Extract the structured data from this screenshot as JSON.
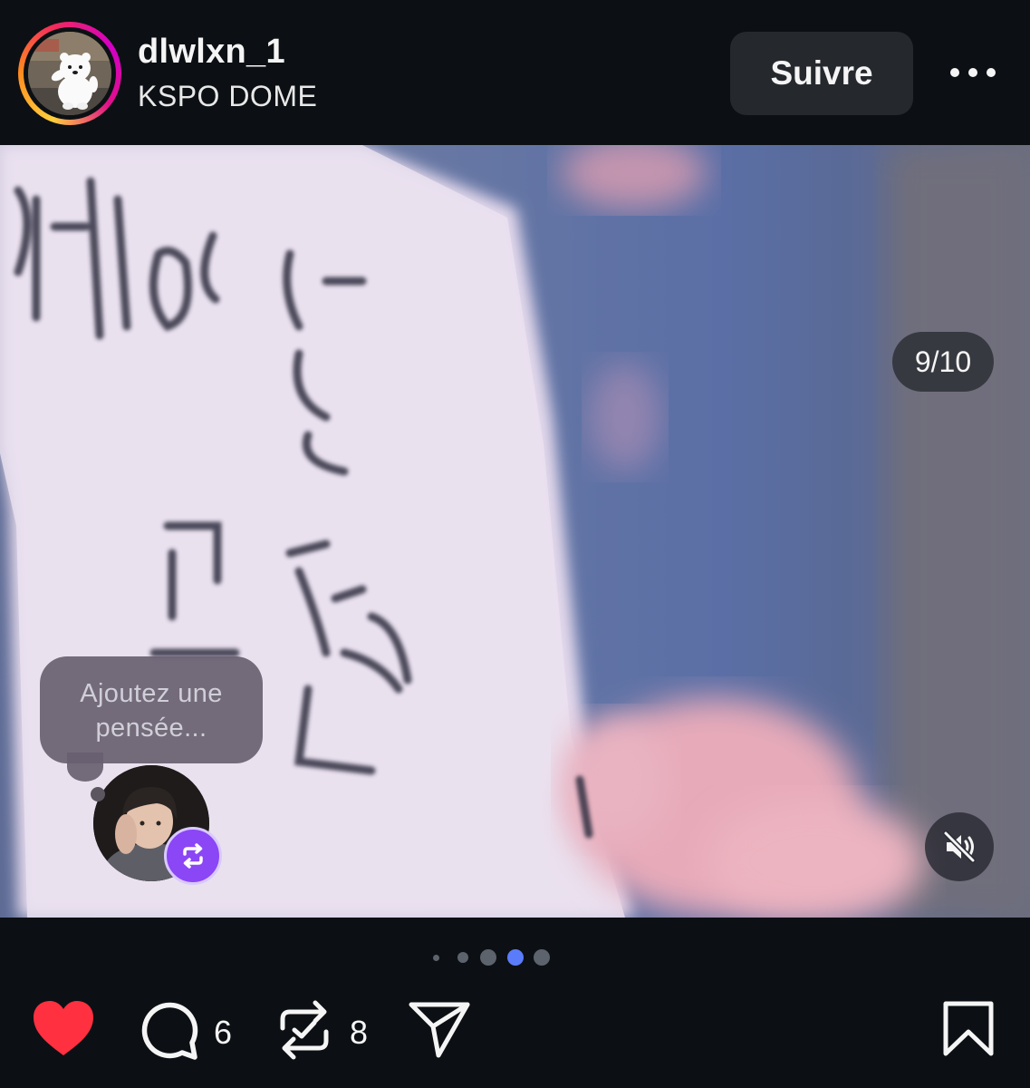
{
  "header": {
    "username": "dlwlxn_1",
    "location": "KSPO DOME",
    "follow_label": "Suivre",
    "avatar_icon": "bear-avatar",
    "story_ring_colors": [
      "#ffcf3d",
      "#ff8a1f",
      "#f2285f",
      "#d300c5"
    ]
  },
  "media": {
    "counter": "9/10",
    "muted": true,
    "thought_placeholder": "Ajoutez une pensée...",
    "carousel_dots": {
      "total": 5,
      "active_index": 3
    }
  },
  "actions": {
    "liked": true,
    "comments": "6",
    "reposts": "8",
    "like_color": "#ff3040",
    "icons": [
      "heart-icon",
      "comment-icon",
      "repost-icon",
      "share-icon",
      "bookmark-icon"
    ]
  },
  "colors": {
    "background": "#0c1014",
    "follow_button": "#25292e",
    "repost_badge": "#8b46f5",
    "active_dot": "#5b7cfa"
  }
}
